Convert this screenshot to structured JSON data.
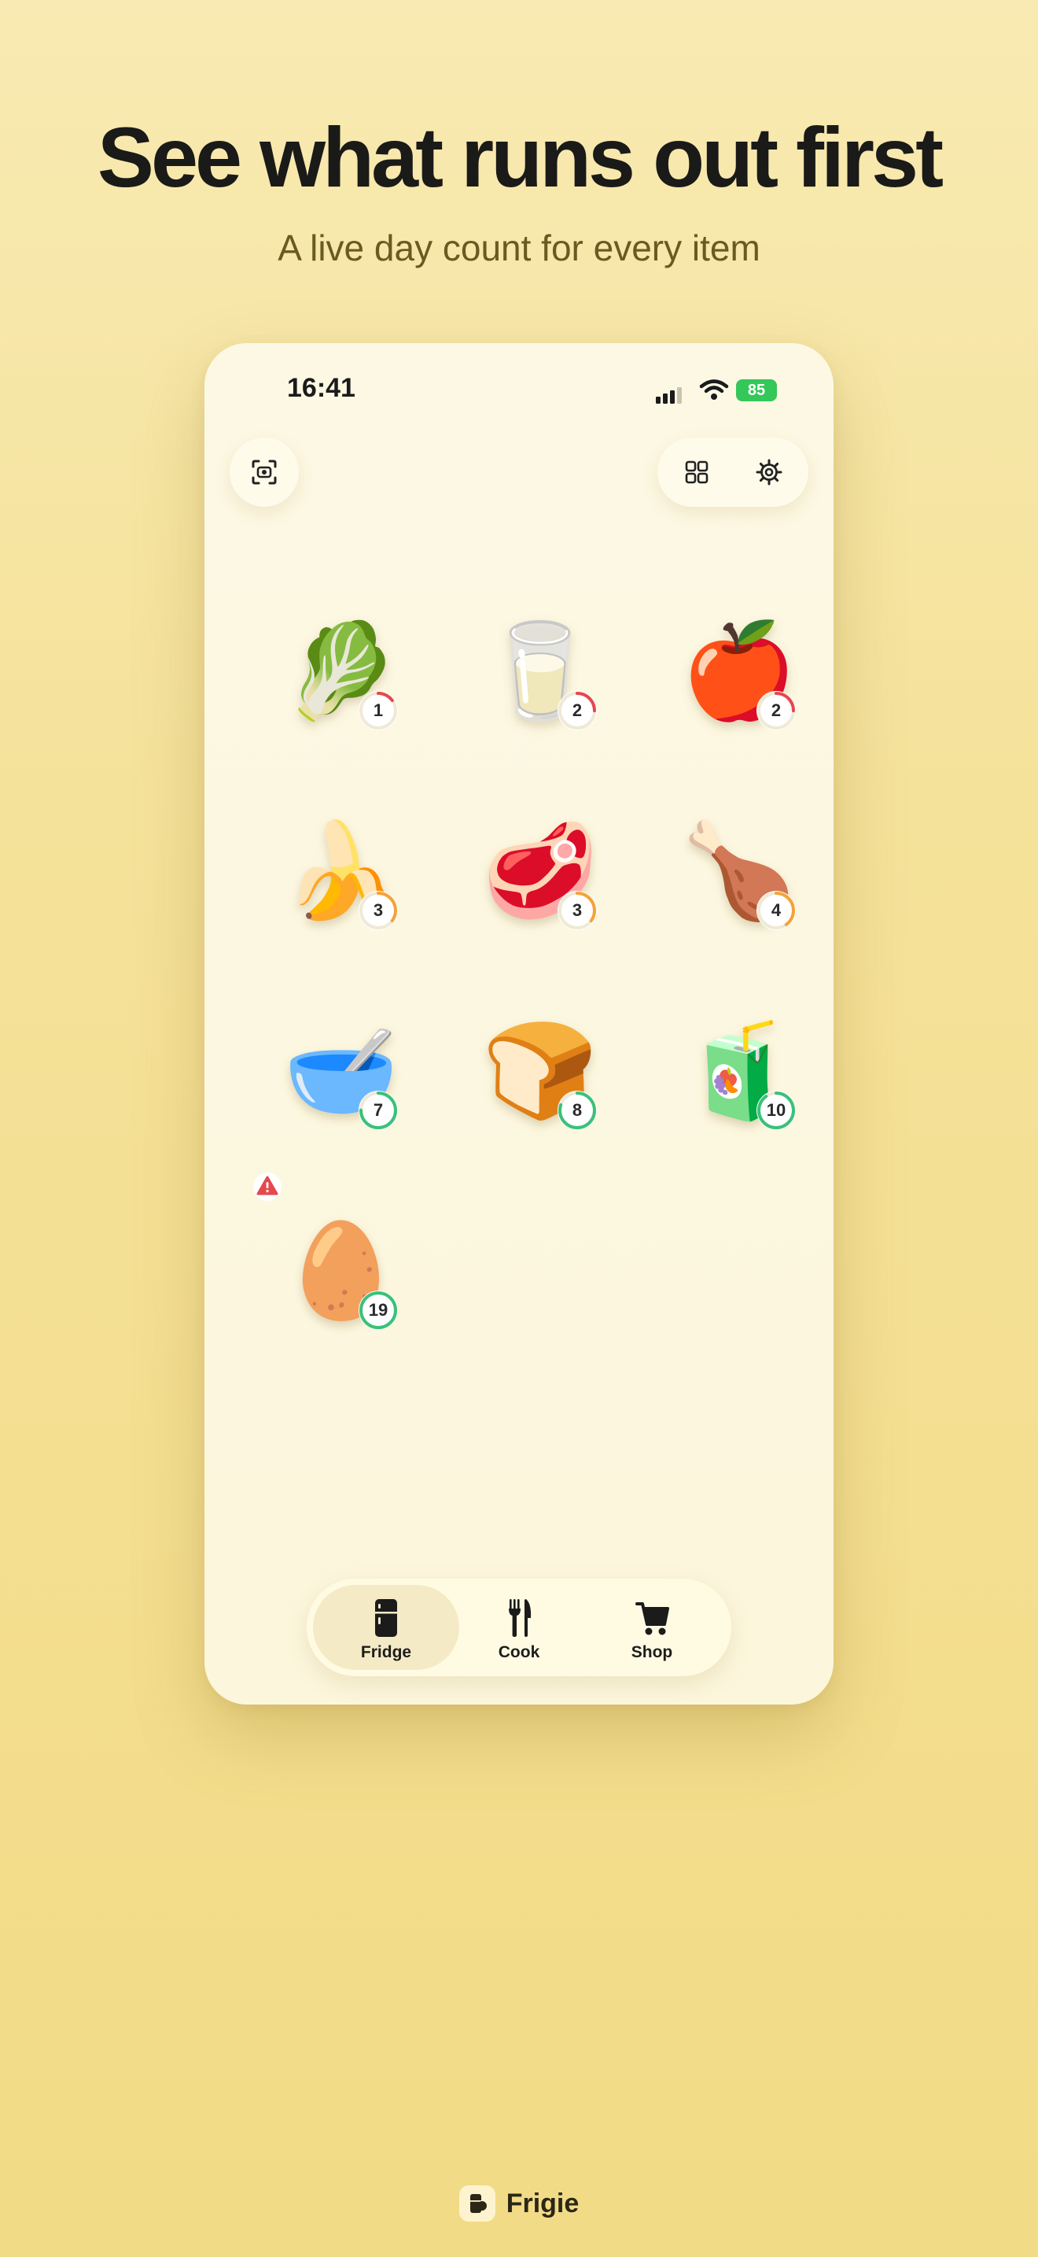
{
  "hero": {
    "headline": "See what runs out first",
    "subtitle": "A live day count for every item"
  },
  "status_bar": {
    "time": "16:41",
    "battery": "85"
  },
  "toolbar": {
    "scan_icon": "scan-icon",
    "grid_icon": "grid-icon",
    "settings_icon": "gear-icon"
  },
  "colors": {
    "urgent": "#e5484d",
    "soon": "#f5a23a",
    "fresh": "#3ac17a",
    "background": "#f5e29a",
    "card": "#fcf6dc"
  },
  "items": [
    {
      "emoji": "🥬",
      "name": "lettuce",
      "days": "1",
      "status": "urgent",
      "ring": 0.15
    },
    {
      "emoji": "🥛",
      "name": "milk",
      "days": "2",
      "status": "urgent",
      "ring": 0.25
    },
    {
      "emoji": "🍎",
      "name": "apple",
      "days": "2",
      "status": "urgent",
      "ring": 0.25
    },
    {
      "emoji": "🍌",
      "name": "banana",
      "days": "3",
      "status": "soon",
      "ring": 0.35
    },
    {
      "emoji": "🥩",
      "name": "steak",
      "days": "3",
      "status": "soon",
      "ring": 0.35
    },
    {
      "emoji": "🍗",
      "name": "chicken-leg",
      "days": "4",
      "status": "soon",
      "ring": 0.4
    },
    {
      "emoji": "🥣",
      "name": "bowl",
      "days": "7",
      "status": "fresh",
      "ring": 0.75
    },
    {
      "emoji": "🍞",
      "name": "bread",
      "days": "8",
      "status": "fresh",
      "ring": 0.8
    },
    {
      "emoji": "🧃",
      "name": "juice-box",
      "days": "10",
      "status": "fresh",
      "ring": 0.9
    },
    {
      "emoji": "🥚",
      "name": "egg",
      "days": "19",
      "status": "fresh",
      "ring": 1.0,
      "alert": true
    }
  ],
  "tabs": [
    {
      "label": "Fridge",
      "icon": "fridge-icon",
      "active": true
    },
    {
      "label": "Cook",
      "icon": "fork-knife-icon",
      "active": false
    },
    {
      "label": "Shop",
      "icon": "cart-icon",
      "active": false
    }
  ],
  "footer": {
    "brand": "Frigie"
  }
}
